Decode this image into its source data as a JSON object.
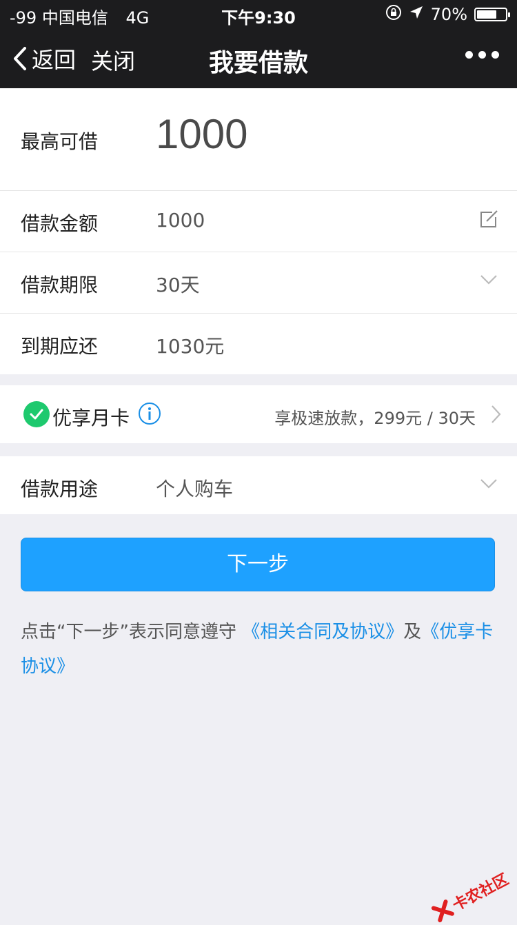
{
  "status_bar": {
    "carrier": "-99 中国电信",
    "network": "4G",
    "time": "下午9:30",
    "battery": "70%",
    "battery_level": 0.7
  },
  "nav": {
    "back_label": "返回",
    "close_label": "关闭",
    "title": "我要借款"
  },
  "loan": {
    "max_label": "最高可借",
    "max_value": "1000",
    "amount_label": "借款金额",
    "amount_value": "1000",
    "term_label": "借款期限",
    "term_value": "30天",
    "repay_label": "到期应还",
    "repay_value": "1030元"
  },
  "card": {
    "label": "优享月卡",
    "desc": "享极速放款，299元 / 30天"
  },
  "purpose": {
    "label": "借款用途",
    "value": "个人购车"
  },
  "actions": {
    "next_label": "下一步"
  },
  "agreement": {
    "prefix": "点击“下一步”表示同意遵守",
    "link1": "《相关合同及协议》",
    "join": "及",
    "link2": "《优享卡协议》"
  },
  "watermark": {
    "text": "卡农社区"
  },
  "colors": {
    "primary": "#1ea1ff",
    "link": "#1a8fe6",
    "check": "#1ec96e",
    "navbar": "#1c1c1e",
    "page_bg": "#efeff4"
  }
}
